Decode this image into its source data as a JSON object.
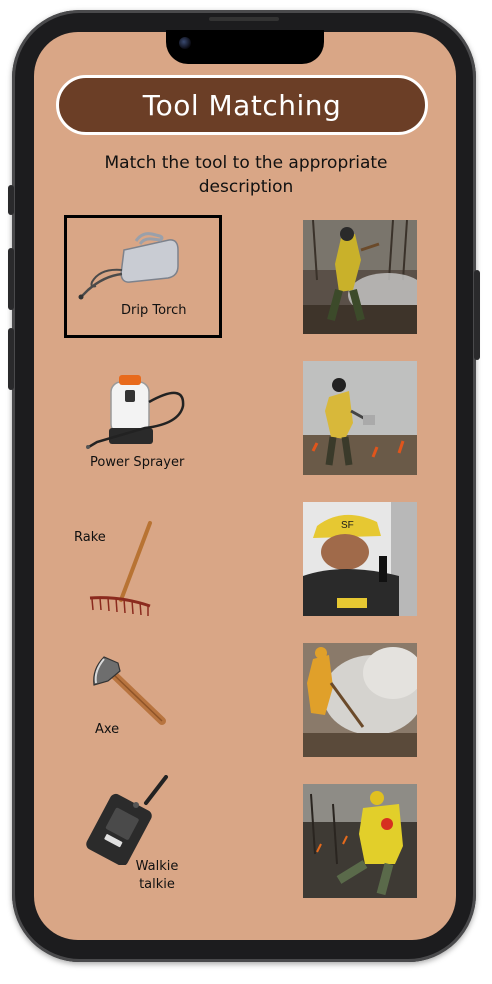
{
  "header": {
    "title": "Tool Matching"
  },
  "instructions": "Match the tool to the appropriate description",
  "tools": [
    {
      "label": "Drip Torch",
      "icon": "drip-torch-icon",
      "selected": true
    },
    {
      "label": "Power Sprayer",
      "icon": "sprayer-icon",
      "selected": false
    },
    {
      "label": "Rake",
      "icon": "rake-icon",
      "selected": false
    },
    {
      "label": "Axe",
      "icon": "axe-icon",
      "selected": false
    },
    {
      "label": "Walkie talkie",
      "label_line1": "Walkie",
      "label_line2": "talkie",
      "icon": "walkie-talkie-icon",
      "selected": false
    }
  ],
  "colors": {
    "screen_bg": "#d9a686",
    "title_bg": "#6b3e26",
    "title_border": "#ffffff",
    "text": "#111111"
  }
}
